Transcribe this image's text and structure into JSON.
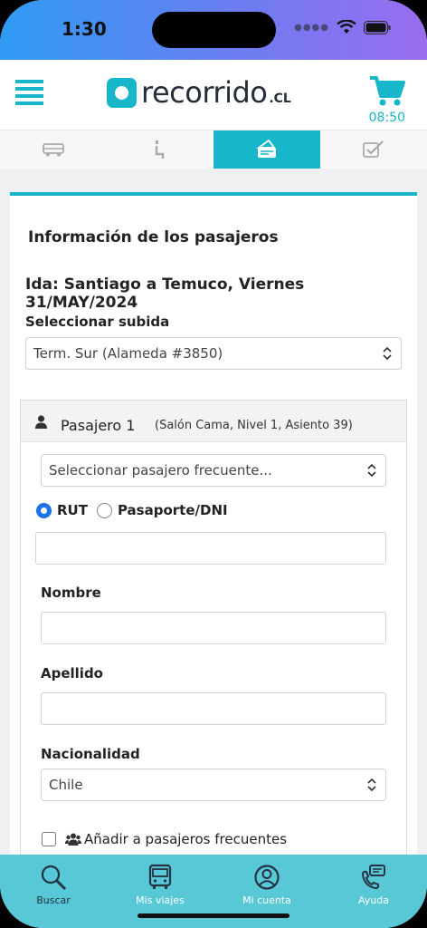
{
  "status": {
    "time": "1:30"
  },
  "header": {
    "logo_text": "recorrido",
    "logo_suffix": ".CL",
    "timer": "08:50"
  },
  "steps": [
    {
      "name": "bus",
      "active": false
    },
    {
      "name": "seat",
      "active": false
    },
    {
      "name": "ticket",
      "active": true
    },
    {
      "name": "check",
      "active": false
    }
  ],
  "form": {
    "section_title": "Información de los pasajeros",
    "route": "Ida: Santiago a Temuco, Viernes 31/MAY/2024",
    "boarding_label": "Seleccionar subida",
    "boarding_value": "Term. Sur (Alameda #3850)",
    "passenger": {
      "name": "Pasajero 1",
      "seat_info": "(Salón Cama, Nivel 1, Asiento 39)",
      "frequent_placeholder": "Seleccionar pasajero frecuente...",
      "id_options": [
        "RUT",
        "Pasaporte/DNI"
      ],
      "id_selected": "RUT",
      "id_value": "",
      "nombre_label": "Nombre",
      "nombre_value": "",
      "apellido_label": "Apellido",
      "apellido_value": "",
      "nacionalidad_label": "Nacionalidad",
      "nacionalidad_value": "Chile",
      "add_frequent_label": "Añadir a pasajeros frecuentes"
    }
  },
  "nav": [
    {
      "label": "Buscar",
      "icon": "search-icon",
      "active": true
    },
    {
      "label": "Mis viajes",
      "icon": "bus-icon",
      "active": false
    },
    {
      "label": "Mi cuenta",
      "icon": "account-icon",
      "active": false
    },
    {
      "label": "Ayuda",
      "icon": "help-icon",
      "active": false
    }
  ],
  "colors": {
    "accent": "#17b6c9",
    "nav_bg": "#58c8d7",
    "radio": "#1a73e8"
  }
}
